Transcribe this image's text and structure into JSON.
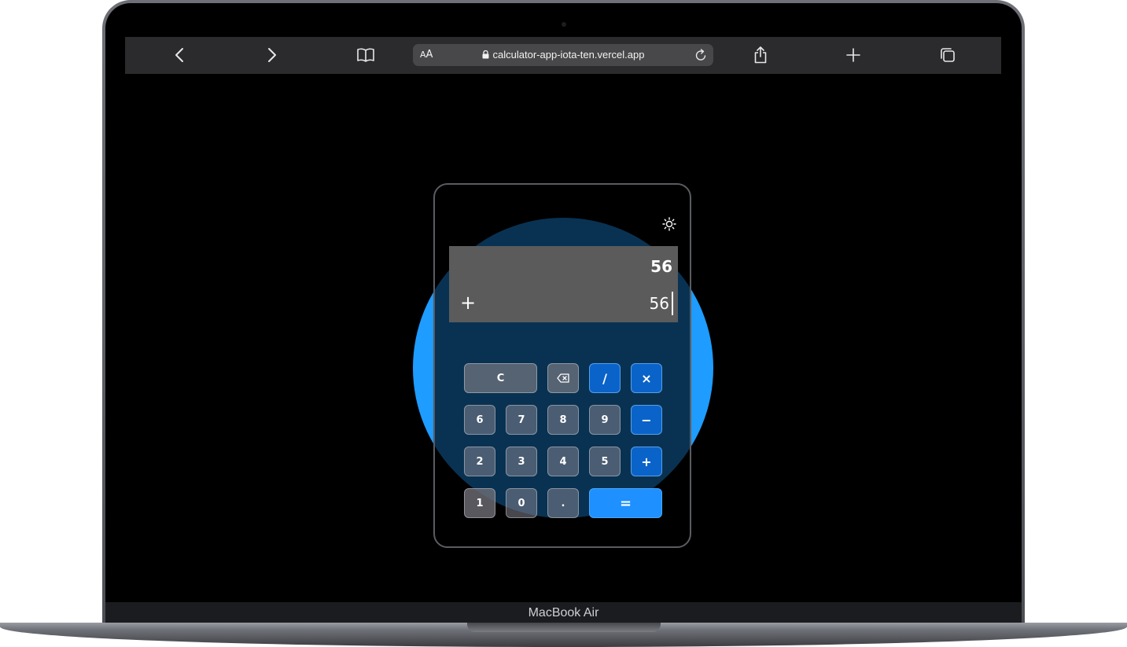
{
  "device": {
    "label": "MacBook Air"
  },
  "browser": {
    "back_icon": "chevron-left-icon",
    "forward_icon": "chevron-right-icon",
    "bookmarks_icon": "book-icon",
    "text_size_small": "A",
    "text_size_large": "A",
    "url": "calculator-app-iota-ten.vercel.app",
    "reload_icon": "reload-icon",
    "share_icon": "share-icon",
    "new_tab_icon": "plus-icon",
    "tabs_icon": "tabs-icon"
  },
  "calculator": {
    "theme_icon": "sun-icon",
    "display": {
      "previous_value": "56",
      "operator": "+",
      "current_value": "56"
    },
    "keys": {
      "clear": "C",
      "backspace_icon": "backspace-icon",
      "divide": "/",
      "multiply": "×",
      "subtract": "−",
      "add": "+",
      "equals": "=",
      "decimal": ".",
      "digits_row1": [
        "6",
        "7",
        "8",
        "9"
      ],
      "digits_row2": [
        "2",
        "3",
        "4",
        "5"
      ],
      "digits_row3": [
        "1",
        "0"
      ]
    },
    "colors": {
      "glow": "#1e9cff",
      "operator_key": "#0a63c9",
      "equals_key": "#1e90ff",
      "display_bg": "#5b5b5b"
    }
  }
}
